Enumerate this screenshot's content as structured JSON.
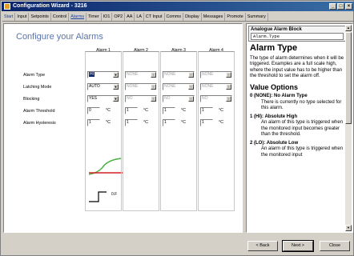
{
  "window": {
    "title": "Configuration Wizard - 3216"
  },
  "tabs": [
    {
      "label": "Start",
      "state": "link"
    },
    {
      "label": "Input",
      "state": ""
    },
    {
      "label": "Setpoints",
      "state": ""
    },
    {
      "label": "Control",
      "state": ""
    },
    {
      "label": "Alarms",
      "state": "active"
    },
    {
      "label": "Timer",
      "state": ""
    },
    {
      "label": "IO1",
      "state": ""
    },
    {
      "label": "OP2",
      "state": ""
    },
    {
      "label": "AA",
      "state": ""
    },
    {
      "label": "LA",
      "state": ""
    },
    {
      "label": "CT Input",
      "state": ""
    },
    {
      "label": "Comms",
      "state": ""
    },
    {
      "label": "Display",
      "state": ""
    },
    {
      "label": "Messages",
      "state": ""
    },
    {
      "label": "Promote",
      "state": ""
    },
    {
      "label": "Summary",
      "state": ""
    }
  ],
  "page": {
    "title": "Configure your Alarms"
  },
  "columns": [
    "Alarm 1",
    "Alarm 2",
    "Alarm 3",
    "Alarm 4"
  ],
  "rows": {
    "type": "Alarm Type",
    "latching": "Latching Mode",
    "blocking": "Blocking",
    "threshold": "Alarm Threshold",
    "hysteresis": "Alarm Hysteresis"
  },
  "alarms": [
    {
      "type": "HI",
      "latching": "AUTO",
      "blocking": "YES",
      "threshold": "0",
      "hysteresis": "1",
      "enabled": true
    },
    {
      "type": "NONE",
      "latching": "NONE",
      "blocking": "NO",
      "threshold": "1",
      "hysteresis": "1",
      "enabled": false
    },
    {
      "type": "NONE",
      "latching": "NONE",
      "blocking": "NO",
      "threshold": "1",
      "hysteresis": "1",
      "enabled": false
    },
    {
      "type": "NONE",
      "latching": "NONE",
      "blocking": "NO",
      "threshold": "1",
      "hysteresis": "1",
      "enabled": false
    }
  ],
  "unit": "°C",
  "graph": {
    "label": "0.F"
  },
  "help": {
    "header_title": "Analogue Alarm Block",
    "header_param": "Alarm.Type",
    "title": "Alarm Type",
    "intro": "The type of alarm determines when it will be triggered. Examples are a full scale high, where the input value has to be higher than the threshold to set the alarm off.",
    "options_title": "Value Options",
    "options": [
      {
        "head": "0 (NONE): No Alarm Type",
        "text": "There is currently no type selected for this alarm."
      },
      {
        "head": "1 (HI): Absolute High",
        "text": "An alarm of this type is triggered when the monitored input becomes greater than the threshold."
      },
      {
        "head": "2 (LO): Absolute Low",
        "text": "An alarm of this type is triggered when the monitored input"
      }
    ]
  },
  "footer": {
    "back": "< Back",
    "next": "Next >",
    "close": "Close"
  },
  "colors": {
    "title_accent": "#5a74b0",
    "graph_red": "#d02020",
    "graph_green": "#4ab040"
  }
}
